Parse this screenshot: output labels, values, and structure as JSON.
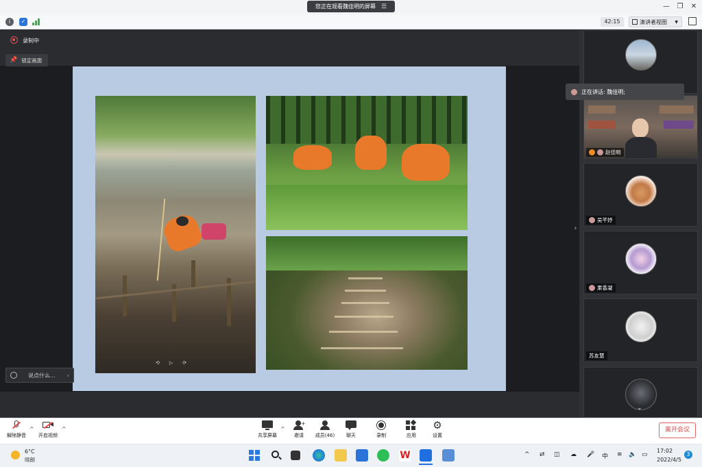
{
  "window": {
    "viewing_banner": "您正在观看魏佳明的屏幕",
    "timer": "42:15",
    "presenter_view_label": "演讲者视图"
  },
  "stage": {
    "recording_label": "录制中",
    "lock_view_label": "锁定画面",
    "chat_placeholder": "说点什么..."
  },
  "participants": {
    "speaking_label": "正在讲话: 魏佳明;",
    "tiles": [
      {
        "name": "赵佳明"
      },
      {
        "name": "吴芊妤"
      },
      {
        "name": "果香凝"
      },
      {
        "name": "苏友慧"
      }
    ]
  },
  "toolbar": {
    "unmute": "解除静音",
    "start_video": "开启视频",
    "share_screen": "共享屏幕",
    "invite": "邀请",
    "members": "成员(46)",
    "chat": "聊天",
    "record": "录制",
    "apps": "应用",
    "settings": "设置",
    "leave": "离开会议"
  },
  "taskbar": {
    "weather_temp": "6°C",
    "weather_desc": "晴朗",
    "ime": "中",
    "time": "17:02",
    "date": "2022/4/5",
    "notifications": "3"
  },
  "colors": {
    "slide_bg": "#b9cbe3",
    "leave_red": "#e04848",
    "record_red": "#e35151",
    "accent_blue": "#1f8ad6"
  }
}
